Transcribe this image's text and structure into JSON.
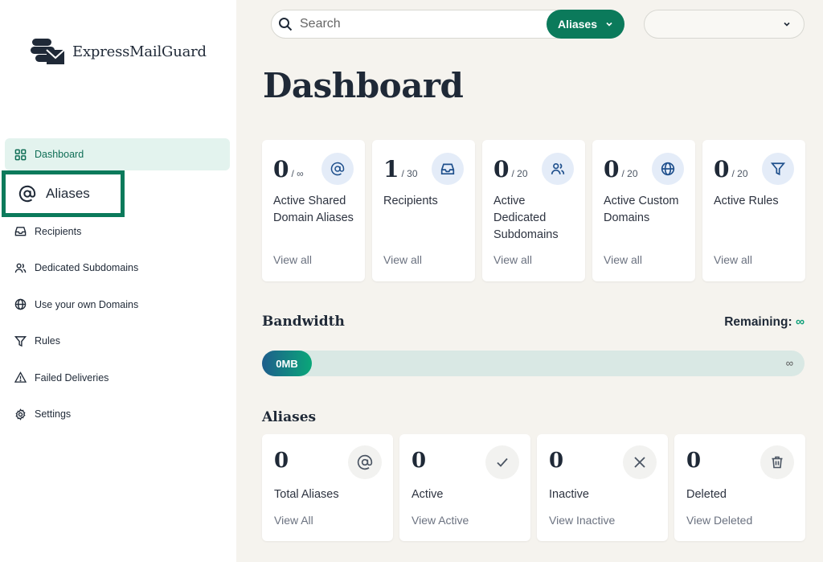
{
  "app": {
    "name": "ExpressMailGuard",
    "accent_color": "#0b7a5b"
  },
  "sidebar": {
    "items": [
      {
        "label": "Dashboard",
        "icon": "grid-icon",
        "active": true
      },
      {
        "label": "Aliases",
        "icon": "at-icon",
        "highlighted": true
      },
      {
        "label": "Recipients",
        "icon": "inbox-icon"
      },
      {
        "label": "Dedicated Subdomains",
        "icon": "users-icon"
      },
      {
        "label": "Use your own Domains",
        "icon": "globe-icon"
      },
      {
        "label": "Rules",
        "icon": "filter-icon"
      },
      {
        "label": "Failed Deliveries",
        "icon": "warning-icon"
      },
      {
        "label": "Settings",
        "icon": "gear-icon"
      }
    ]
  },
  "search": {
    "placeholder": "Search",
    "scope_label": "Aliases"
  },
  "user_menu": {
    "label": ""
  },
  "page": {
    "title": "Dashboard"
  },
  "stats": [
    {
      "value": "0",
      "max": "/ ∞",
      "label": "Active Shared Domain Aliases",
      "link": "View all",
      "icon": "at-icon"
    },
    {
      "value": "1",
      "max": "/ 30",
      "label": "Recipients",
      "link": "View all",
      "icon": "inbox-icon"
    },
    {
      "value": "0",
      "max": "/ 20",
      "label": "Active Dedicated Subdomains",
      "link": "View all",
      "icon": "users-icon"
    },
    {
      "value": "0",
      "max": "/ 20",
      "label": "Active Custom Domains",
      "link": "View all",
      "icon": "globe-icon"
    },
    {
      "value": "0",
      "max": "/ 20",
      "label": "Active Rules",
      "link": "View all",
      "icon": "filter-icon"
    }
  ],
  "bandwidth": {
    "title": "Bandwidth",
    "remaining_label": "Remaining:",
    "remaining_value": "∞",
    "used": "0MB",
    "max": "∞"
  },
  "aliases": {
    "title": "Aliases",
    "cards": [
      {
        "value": "0",
        "label": "Total Aliases",
        "link": "View All",
        "icon": "at-icon"
      },
      {
        "value": "0",
        "label": "Active",
        "link": "View Active",
        "icon": "check-icon"
      },
      {
        "value": "0",
        "label": "Inactive",
        "link": "View Inactive",
        "icon": "close-icon"
      },
      {
        "value": "0",
        "label": "Deleted",
        "link": "View Deleted",
        "icon": "trash-icon"
      }
    ]
  }
}
